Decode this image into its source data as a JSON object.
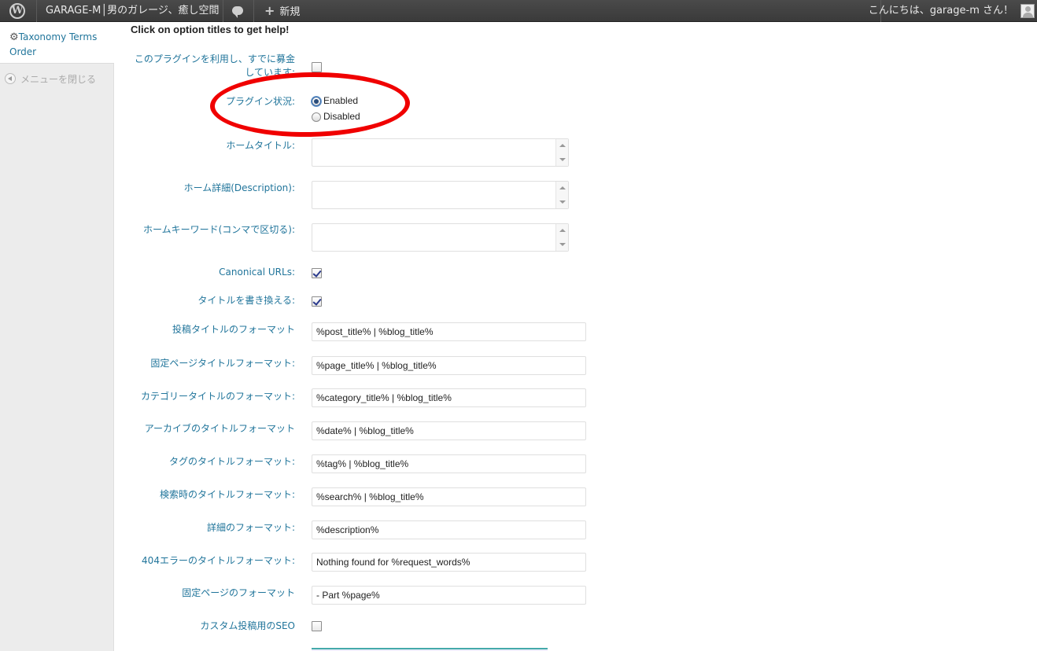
{
  "adminbar": {
    "site_name": "GARAGE-M│男のガレージ、癒し空間",
    "new_label": "新規",
    "howdy": "こんにちは、garage-m さん！"
  },
  "sidebar": {
    "item_label": "Taxonomy Terms Order",
    "collapse_label": "メニューを閉じる"
  },
  "main": {
    "help_title": "Click on option titles to get help!",
    "fields": {
      "donated": {
        "label": "このプラグインを利用し、すでに募金しています:",
        "checked": false
      },
      "plugin_status": {
        "label": "プラグイン状況:",
        "options": [
          "Enabled",
          "Disabled"
        ],
        "selected": "Enabled"
      },
      "home_title": {
        "label": "ホームタイトル:",
        "value": ""
      },
      "home_description": {
        "label": "ホーム詳細(Description):",
        "value": ""
      },
      "home_keywords": {
        "label": "ホームキーワード(コンマで区切る):",
        "value": ""
      },
      "canonical_urls": {
        "label": "Canonical URLs:",
        "checked": true
      },
      "rewrite_titles": {
        "label": "タイトルを書き換える:",
        "checked": true
      },
      "post_title_format": {
        "label": "投稿タイトルのフォーマット",
        "value": "%post_title% | %blog_title%"
      },
      "page_title_format": {
        "label": "固定ページタイトルフォーマット:",
        "value": "%page_title% | %blog_title%"
      },
      "category_title_format": {
        "label": "カテゴリータイトルのフォーマット:",
        "value": "%category_title% | %blog_title%"
      },
      "archive_title_format": {
        "label": "アーカイブのタイトルフォーマット",
        "value": "%date% | %blog_title%"
      },
      "tag_title_format": {
        "label": "タグのタイトルフォーマット:",
        "value": "%tag% | %blog_title%"
      },
      "search_title_format": {
        "label": "検索時のタイトルフォーマット:",
        "value": "%search% | %blog_title%"
      },
      "description_format": {
        "label": "詳細のフォーマット:",
        "value": "%description%"
      },
      "404_title_format": {
        "label": "404エラーのタイトルフォーマット:",
        "value": "Nothing found for %request_words%"
      },
      "paged_format": {
        "label": "固定ページのフォーマット",
        "value": " - Part %page%"
      },
      "custom_post_seo": {
        "label": "カスタム投稿用のSEO",
        "checked": false
      }
    }
  },
  "annotation": {
    "color": "#f00000",
    "shape": "ellipse"
  }
}
